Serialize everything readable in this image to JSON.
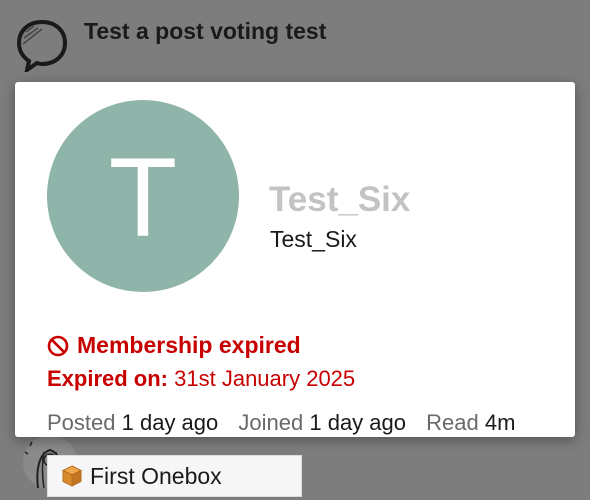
{
  "topic": {
    "title": "Test a post voting test",
    "icon": "speech-bubble-icon"
  },
  "user_card": {
    "avatar_letter": "T",
    "avatar_color": "#8fb5ab",
    "display_name": "Test_Six",
    "username": "Test_Six",
    "status": {
      "icon": "prohibited-icon",
      "text": "Membership expired",
      "color": "#c80000"
    },
    "expiry": {
      "label": "Expired on:",
      "value": "31st January 2025"
    },
    "stats": {
      "posted_label": "Posted",
      "posted_value": "1 day ago",
      "joined_label": "Joined",
      "joined_value": "1 day ago",
      "read_label": "Read",
      "read_value": "4m"
    },
    "badge": {
      "icon": "cube-icon",
      "label": "First Onebox"
    }
  }
}
